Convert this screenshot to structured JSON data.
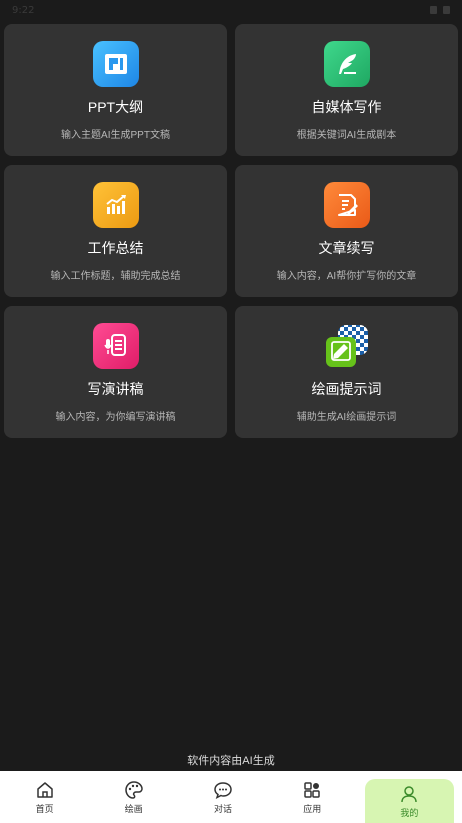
{
  "status": {
    "time": "9:22"
  },
  "cards": [
    {
      "title": "PPT大纲",
      "desc": "输入主题AI生成PPT文稿",
      "icon": "ppt-icon",
      "color": "#2ea6f0"
    },
    {
      "title": "自媒体写作",
      "desc": "根据关键词AI生成剧本",
      "icon": "feather-icon",
      "color": "#2fc077"
    },
    {
      "title": "工作总结",
      "desc": "输入工作标题，辅助完成总结",
      "icon": "chart-icon",
      "color": "#f0a91a"
    },
    {
      "title": "文章续写",
      "desc": "输入内容，AI帮你扩写你的文章",
      "icon": "document-edit-icon",
      "color": "#f06a24"
    },
    {
      "title": "写演讲稿",
      "desc": "输入内容，为你编写演讲稿",
      "icon": "microphone-icon",
      "color": "#f0307c"
    },
    {
      "title": "绘画提示词",
      "desc": "辅助生成AI绘画提示词",
      "icon": "paint-edit-icon",
      "color": "#66c21a"
    }
  ],
  "footer_note": "软件内容由AI生成",
  "tabs": [
    {
      "label": "首页",
      "icon": "home-icon"
    },
    {
      "label": "绘画",
      "icon": "palette-icon"
    },
    {
      "label": "对话",
      "icon": "chat-icon"
    },
    {
      "label": "应用",
      "icon": "apps-icon"
    },
    {
      "label": "我的",
      "icon": "user-icon",
      "active": true
    }
  ]
}
